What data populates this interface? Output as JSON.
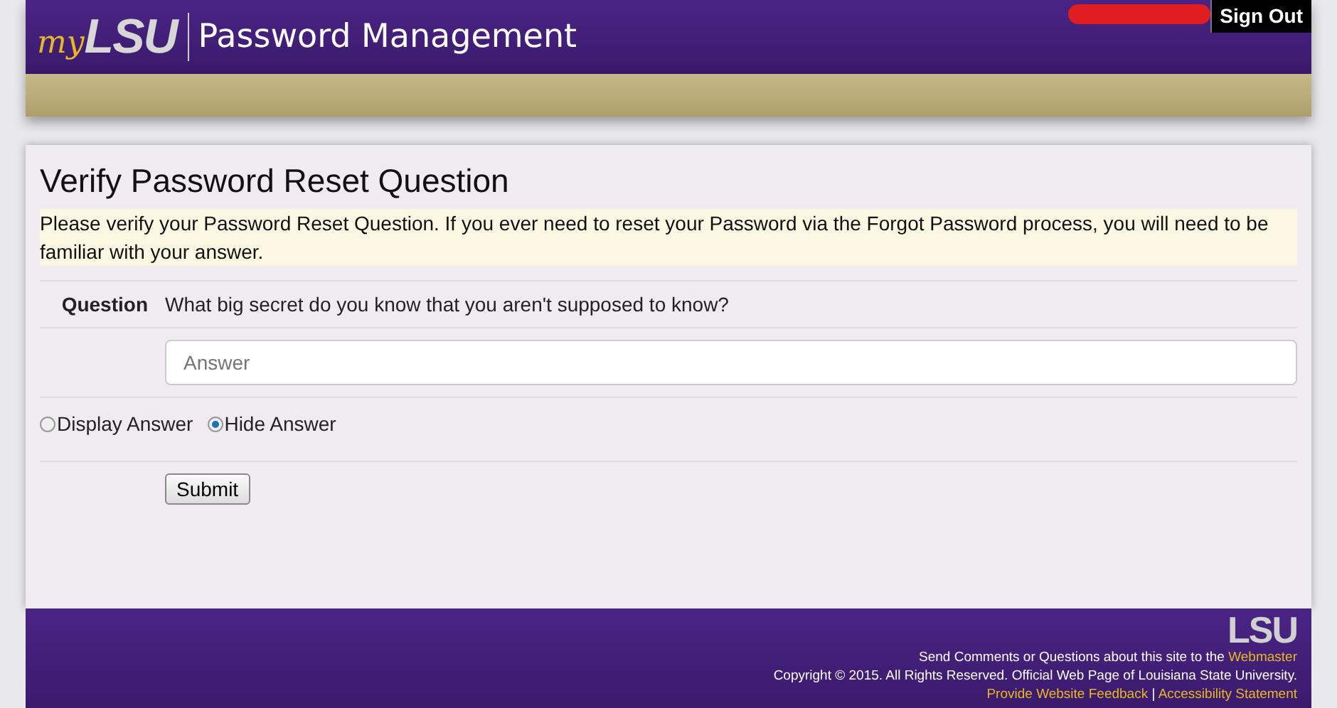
{
  "header": {
    "logo_prefix": "my",
    "logo": "LSU",
    "title": "Password Management",
    "sign_out": "Sign Out"
  },
  "form": {
    "heading": "Verify Password Reset Question",
    "notice": "Please verify your Password Reset Question. If you ever need to reset your Password via the Forgot Password process, you will need to be familiar with your answer.",
    "question_label": "Question",
    "question": "What big secret do you know that you aren't supposed to know?",
    "answer": {
      "placeholder": "Answer"
    },
    "options": [
      {
        "label": "Display Answer",
        "selected": false
      },
      {
        "label": "Hide Answer",
        "selected": true
      }
    ],
    "submit": "Submit"
  },
  "footer": {
    "logo": "LSU",
    "comments": "Send Comments or Questions about this site to the",
    "webmaster": "Webmaster",
    "copyright": "Copyright © 2015. All Rights Reserved. Official Web Page of Louisiana State University.",
    "links": [
      "Provide Website Feedback",
      "Accessibility Statement"
    ],
    "separator": "|"
  }
}
